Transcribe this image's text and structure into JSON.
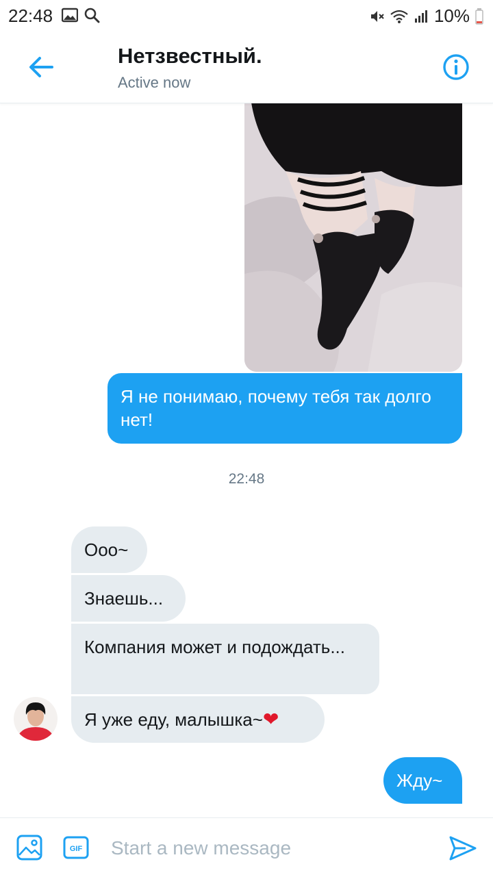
{
  "status_bar": {
    "time": "22:48",
    "battery": "10%",
    "icons": [
      "image-icon",
      "search-icon",
      "mute-icon",
      "wifi-icon",
      "signal-icon",
      "battery-icon"
    ]
  },
  "header": {
    "name": "Нетзвестный.",
    "status": "Active now",
    "icons": [
      "back-arrow-icon",
      "info-icon"
    ]
  },
  "messages": {
    "sent_1": "Я не понимаю, почему тебя так долго нет!",
    "timestamp": "22:48",
    "recv_1": "Ооо~",
    "recv_2": "Знаешь...",
    "recv_3": "Компания может и подождать...",
    "recv_4": "Я уже еду, малышка~",
    "recv_4_emoji": "❤",
    "sent_2": "Жду~"
  },
  "composer": {
    "placeholder": "Start a new message",
    "gif_label": "GIF",
    "icons": [
      "media-icon",
      "gif-icon",
      "send-icon"
    ]
  },
  "colors": {
    "accent": "#1da1f2",
    "incoming_bubble": "#e6ecf0",
    "secondary_text": "#657786",
    "placeholder": "#aab8c2"
  }
}
